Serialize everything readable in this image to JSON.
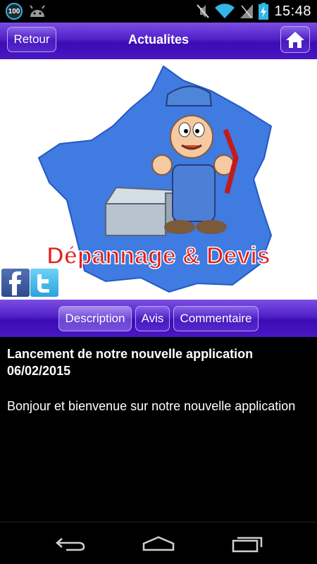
{
  "status_bar": {
    "notification_badge": "100",
    "time": "15:48",
    "icons": [
      "circle-badge-icon",
      "android-icon",
      "mute-icon",
      "wifi-icon",
      "signal-icon",
      "battery-charging-icon"
    ]
  },
  "header": {
    "back_label": "Retour",
    "title": "Actualites",
    "home_icon": "home-icon"
  },
  "banner": {
    "logo_text": "Dépannage & Devis",
    "social": [
      "facebook-icon",
      "twitter-icon"
    ]
  },
  "tabs": [
    {
      "label": "Description",
      "active": true
    },
    {
      "label": "Avis",
      "active": false
    },
    {
      "label": "Commentaire",
      "active": false
    }
  ],
  "content": {
    "title": "Lancement de notre nouvelle application",
    "date": "06/02/2015",
    "body": "Bonjour et bienvenue sur notre nouvelle application"
  },
  "navbar": {
    "icons": [
      "back-icon",
      "home-nav-icon",
      "recent-apps-icon"
    ]
  },
  "colors": {
    "header_purple": "#4a17c3",
    "logo_red": "#e0201c",
    "map_blue": "#3f7be0"
  }
}
